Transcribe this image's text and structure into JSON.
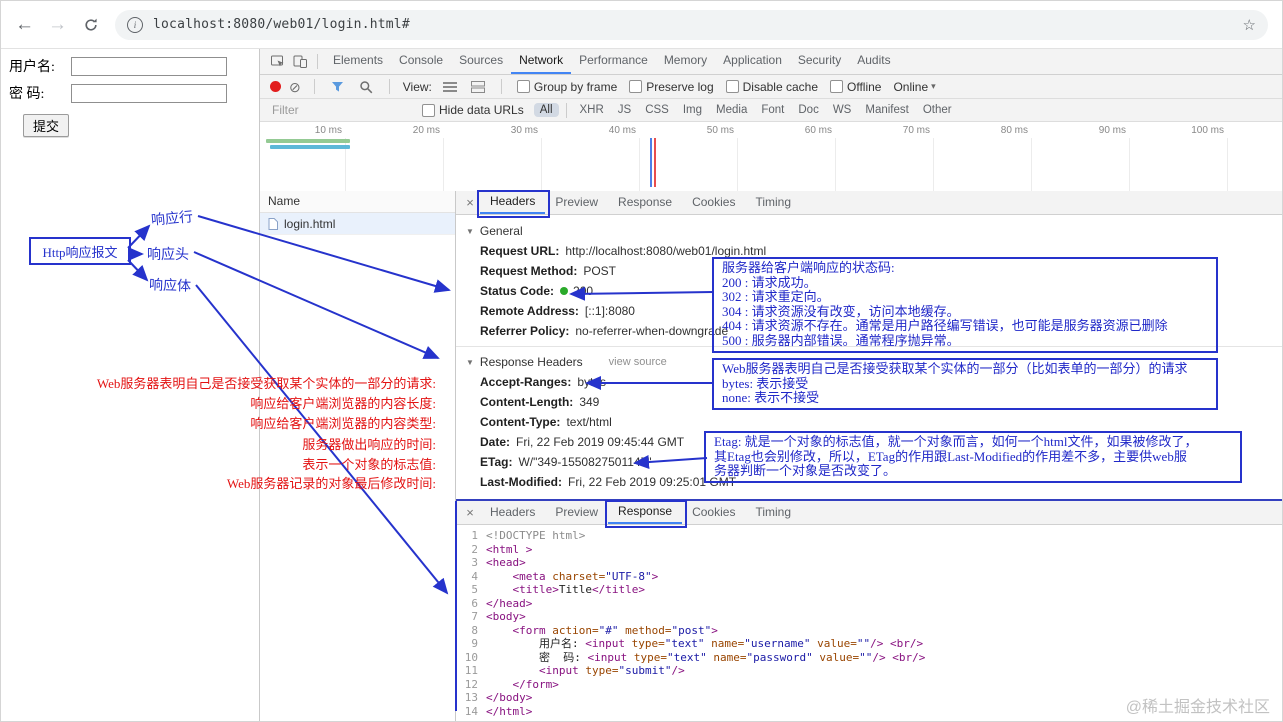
{
  "browser": {
    "url": "localhost:8080/web01/login.html#"
  },
  "page": {
    "username_label": "用户名:",
    "password_label": "密 码:",
    "submit_label": "提交"
  },
  "devtools": {
    "tabs": [
      "Elements",
      "Console",
      "Sources",
      "Network",
      "Performance",
      "Memory",
      "Application",
      "Security",
      "Audits"
    ],
    "active_tab": "Network",
    "toolbar": {
      "view_label": "View:",
      "options": [
        "Group by frame",
        "Preserve log",
        "Disable cache",
        "Offline"
      ],
      "throttling": "Online"
    },
    "filterbar": {
      "placeholder": "Filter",
      "hide_data_urls": "Hide data URLs",
      "types": [
        "All",
        "XHR",
        "JS",
        "CSS",
        "Img",
        "Media",
        "Font",
        "Doc",
        "WS",
        "Manifest",
        "Other"
      ],
      "active_type": "All"
    },
    "timeline": {
      "ticks": [
        "10 ms",
        "20 ms",
        "30 ms",
        "40 ms",
        "50 ms",
        "60 ms",
        "70 ms",
        "80 ms",
        "90 ms",
        "100 ms"
      ]
    },
    "request_list": {
      "header": "Name",
      "rows": [
        "login.html"
      ]
    },
    "details": {
      "tabs": [
        "Headers",
        "Preview",
        "Response",
        "Cookies",
        "Timing"
      ],
      "active_tab": "Headers",
      "sections": {
        "general_title": "General",
        "general": [
          {
            "key": "Request URL:",
            "value": "http://localhost:8080/web01/login.html"
          },
          {
            "key": "Request Method:",
            "value": "POST"
          },
          {
            "key": "Status Code:",
            "value": "200",
            "status_dot": true
          },
          {
            "key": "Remote Address:",
            "value": "[::1]:8080"
          },
          {
            "key": "Referrer Policy:",
            "value": "no-referrer-when-downgrade"
          }
        ],
        "response_headers_title": "Response Headers",
        "view_source_label": "view source",
        "response_headers": [
          {
            "key": "Accept-Ranges:",
            "value": "bytes"
          },
          {
            "key": "Content-Length:",
            "value": "349"
          },
          {
            "key": "Content-Type:",
            "value": "text/html"
          },
          {
            "key": "Date:",
            "value": "Fri, 22 Feb 2019 09:45:44 GMT"
          },
          {
            "key": "ETag:",
            "value": "W/\"349-1550827501147\""
          },
          {
            "key": "Last-Modified:",
            "value": "Fri, 22 Feb 2019 09:25:01 GMT"
          }
        ]
      }
    },
    "response_viewer": {
      "tabs": [
        "Headers",
        "Preview",
        "Response",
        "Cookies",
        "Timing"
      ],
      "active_tab": "Response",
      "code": [
        {
          "n": 1,
          "segs": [
            [
              "g",
              "<!DOCTYPE html>"
            ]
          ]
        },
        {
          "n": 2,
          "segs": [
            [
              "t",
              "<html >"
            ]
          ]
        },
        {
          "n": 3,
          "segs": [
            [
              "t",
              "<head>"
            ]
          ]
        },
        {
          "n": 4,
          "segs": [
            [
              "x",
              "    "
            ],
            [
              "t",
              "<meta"
            ],
            [
              "a",
              " charset="
            ],
            [
              "v",
              "\"UTF-8\""
            ],
            [
              "t",
              ">"
            ]
          ]
        },
        {
          "n": 5,
          "segs": [
            [
              "x",
              "    "
            ],
            [
              "t",
              "<title>"
            ],
            [
              "x",
              "Title"
            ],
            [
              "t",
              "</title>"
            ]
          ]
        },
        {
          "n": 6,
          "segs": [
            [
              "t",
              "</head>"
            ]
          ]
        },
        {
          "n": 7,
          "segs": [
            [
              "t",
              "<body>"
            ]
          ]
        },
        {
          "n": 8,
          "segs": [
            [
              "x",
              "    "
            ],
            [
              "t",
              "<form"
            ],
            [
              "a",
              " action="
            ],
            [
              "v",
              "\"#\""
            ],
            [
              "a",
              " method="
            ],
            [
              "v",
              "\"post\""
            ],
            [
              "t",
              ">"
            ]
          ]
        },
        {
          "n": 9,
          "segs": [
            [
              "x",
              "        用户名: "
            ],
            [
              "t",
              "<input"
            ],
            [
              "a",
              " type="
            ],
            [
              "v",
              "\"text\""
            ],
            [
              "a",
              " name="
            ],
            [
              "v",
              "\"username\""
            ],
            [
              "a",
              " value="
            ],
            [
              "v",
              "\"\""
            ],
            [
              "t",
              "/>"
            ],
            [
              "x",
              " "
            ],
            [
              "t",
              "<br/>"
            ]
          ]
        },
        {
          "n": 10,
          "segs": [
            [
              "x",
              "        密  码: "
            ],
            [
              "t",
              "<input"
            ],
            [
              "a",
              " type="
            ],
            [
              "v",
              "\"text\""
            ],
            [
              "a",
              " name="
            ],
            [
              "v",
              "\"password\""
            ],
            [
              "a",
              " value="
            ],
            [
              "v",
              "\"\""
            ],
            [
              "t",
              "/>"
            ],
            [
              "x",
              " "
            ],
            [
              "t",
              "<br/>"
            ]
          ]
        },
        {
          "n": 11,
          "segs": [
            [
              "x",
              "        "
            ],
            [
              "t",
              "<input"
            ],
            [
              "a",
              " type="
            ],
            [
              "v",
              "\"submit\""
            ],
            [
              "t",
              "/>"
            ]
          ]
        },
        {
          "n": 12,
          "segs": [
            [
              "x",
              "    "
            ],
            [
              "t",
              "</form>"
            ]
          ]
        },
        {
          "n": 13,
          "segs": [
            [
              "t",
              "</body>"
            ]
          ]
        },
        {
          "n": 14,
          "segs": [
            [
              "t",
              "</html>"
            ]
          ]
        }
      ]
    }
  },
  "annotations": {
    "legend_box": "Http响应报文",
    "part_labels": [
      "响应行",
      "响应头",
      "响应体"
    ],
    "red_notes": [
      "Web服务器表明自己是否接受获取某个实体的一部分的请求:",
      "响应给客户端浏览器的内容长度:",
      "响应给客户端浏览器的内容类型:",
      "服务器做出响应的时间:",
      "表示一个对象的标志值:",
      "Web服务器记录的对象最后修改时间:"
    ],
    "note_boxes": [
      {
        "lines": [
          "服务器给客户端响应的状态码:",
          "200 : 请求成功。",
          "302 : 请求重定向。",
          "304 : 请求资源没有改变，访问本地缓存。",
          "404 : 请求资源不存在。通常是用户路径编写错误，也可能是服务器资源已删除",
          "500 : 服务器内部错误。通常程序抛异常。"
        ]
      },
      {
        "lines": [
          "Web服务器表明自己是否接受获取某个实体的一部分（比如表单的一部分）的请求",
          "bytes: 表示接受",
          "none: 表示不接受"
        ]
      },
      {
        "lines": [
          "Etag: 就是一个对象的标志值，就一个对象而言，如何一个html文件，如果被修改了，",
          "其Etag也会别修改，所以，ETag的作用跟Last-Modified的作用差不多，主要供web服",
          "务器判断一个对象是否改变了。"
        ]
      }
    ]
  },
  "watermark": "@稀土掘金技术社区"
}
